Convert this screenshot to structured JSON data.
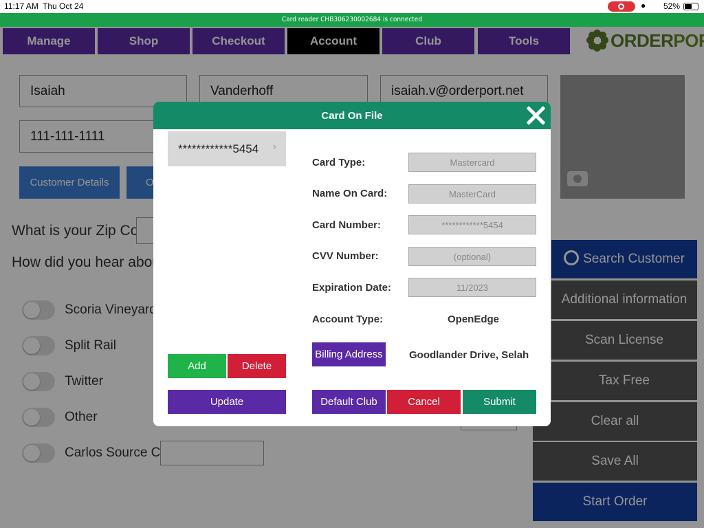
{
  "status": {
    "time": "11:17 AM",
    "date": "Thu Oct 24",
    "battery": "52%"
  },
  "reader_msg": "Card reader CHB306230002684 is connected",
  "nav": {
    "tabs": [
      "Manage",
      "Shop",
      "Checkout",
      "Account",
      "Club",
      "Tools"
    ],
    "active": "Account"
  },
  "logo": {
    "part1": "ORDER",
    "part2": "PORT"
  },
  "form": {
    "first_name": "Isaiah",
    "last_name": "Vanderhoff",
    "email": "isaiah.v@orderport.net",
    "phone": "111-111-1111",
    "customer_details": "Customer Details",
    "second_btn_fragment": "O",
    "zip_question": "What is your Zip Code?",
    "hear_question": "How did you hear about us?"
  },
  "sources": [
    "Scoria Vineyard",
    "Split Rail",
    "Twitter",
    "Other",
    "Carlos Source Code"
  ],
  "side": [
    "Search Customer",
    "Additional information",
    "Scan License",
    "Tax Free",
    "Clear all",
    "Save All",
    "Start Order"
  ],
  "modal": {
    "title": "Card On File",
    "card_masked": "************5454",
    "labels": {
      "card_type": "Card Type:",
      "name_on_card": "Name On Card:",
      "card_number": "Card Number:",
      "cvv": "CVV Number:",
      "exp": "Expiration Date:",
      "account_type": "Account Type:"
    },
    "values": {
      "card_type": "Mastercard",
      "name_on_card": "MasterCard",
      "card_number": "************5454",
      "cvv_placeholder": "(optional)",
      "exp": "11/2023",
      "account_type": "OpenEdge",
      "billing_address": "Goodlander Drive, Selah"
    },
    "buttons": {
      "add": "Add",
      "delete": "Delete",
      "update": "Update",
      "billing": "Billing Address",
      "default_club": "Default Club",
      "cancel": "Cancel",
      "submit": "Submit"
    }
  },
  "colors": {
    "purple": "#5a2aa6",
    "green_header": "#148a67",
    "reader_green": "#1aa04a",
    "red": "#d01f37",
    "add_green": "#20b34a"
  }
}
